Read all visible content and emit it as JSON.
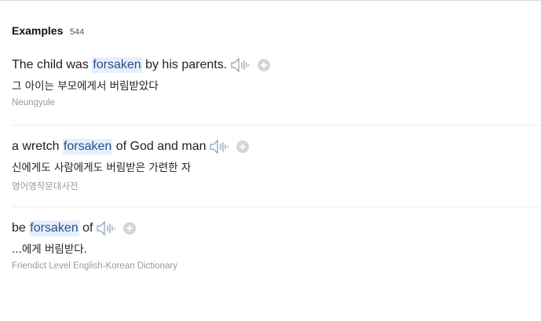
{
  "section": {
    "title": "Examples",
    "count": "544"
  },
  "examples": [
    {
      "pre": "The child was ",
      "keyword": "forsaken",
      "post": " by his parents.",
      "translation": "그 아이는 부모에게서 버림받았다",
      "source": "Neungyule",
      "speaker_icon": "speaker-icon",
      "add_icon": "plus-circle-icon"
    },
    {
      "pre": "a wretch ",
      "keyword": "forsaken",
      "post": " of God and man",
      "translation": "신에게도 사람에게도 버림받은 가련한 자",
      "source": "영어영작문대사전",
      "speaker_icon": "speaker-icon",
      "add_icon": "plus-circle-icon"
    },
    {
      "pre": "be ",
      "keyword": "forsaken",
      "post": " of",
      "translation": "...에게 버림받다.",
      "source": "Friendict Level English-Korean Dictionary",
      "speaker_icon": "speaker-icon",
      "add_icon": "plus-circle-icon"
    }
  ],
  "colors": {
    "highlight_bg": "#e6f0fb",
    "highlight_text": "#2b4f86",
    "source_text": "#9a9a9a"
  }
}
